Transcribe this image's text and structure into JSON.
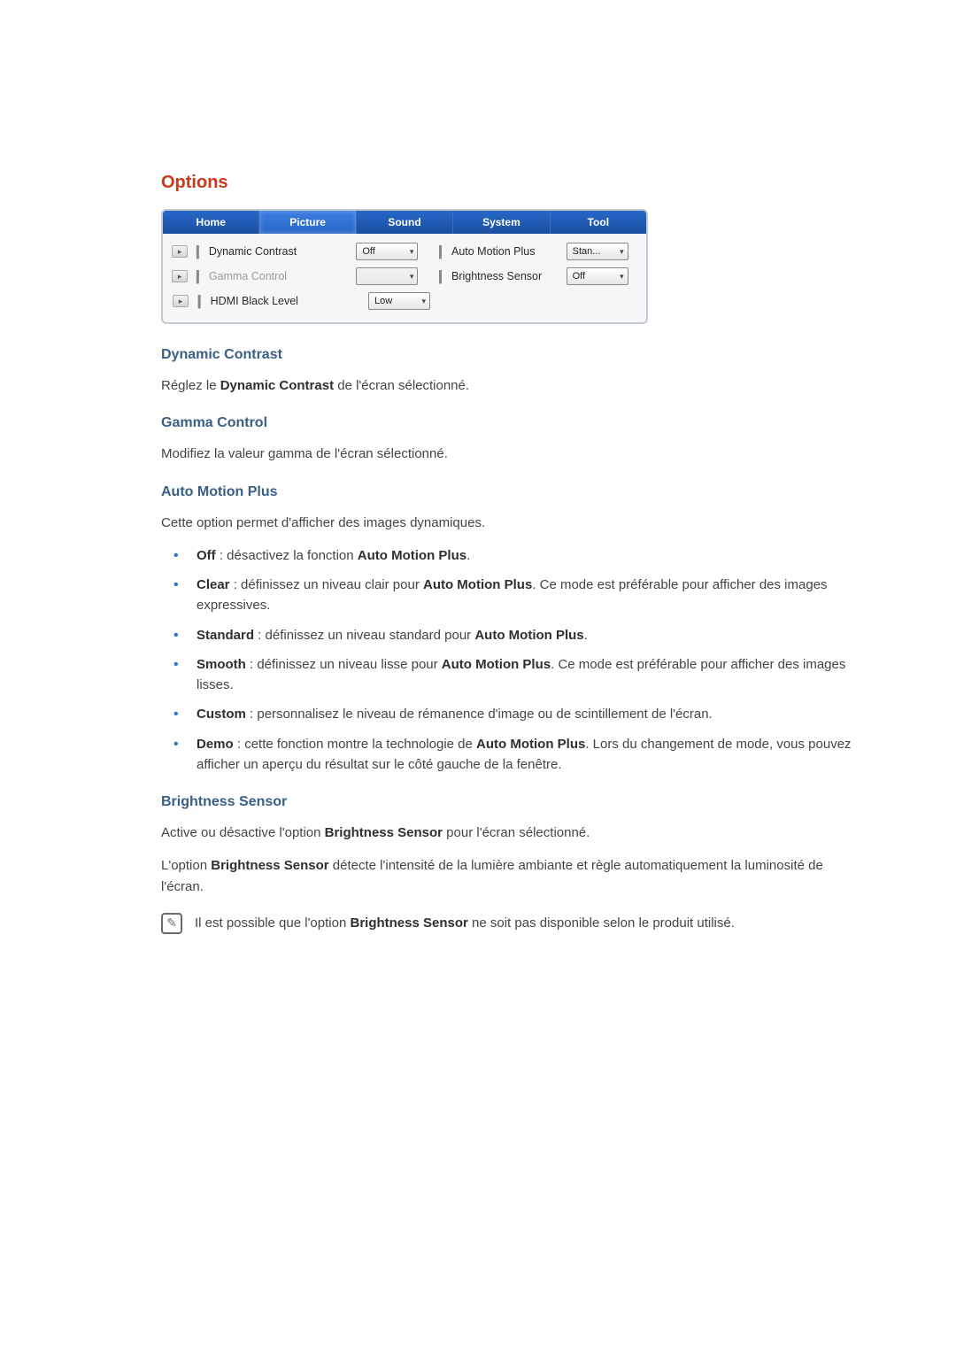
{
  "section_title": "Options",
  "panel": {
    "tabs": {
      "home": "Home",
      "picture": "Picture",
      "sound": "Sound",
      "system": "System",
      "tool": "Tool"
    },
    "rows": {
      "dynamic_contrast": {
        "label": "Dynamic Contrast",
        "value": "Off"
      },
      "gamma_control": {
        "label": "Gamma Control",
        "value": ""
      },
      "hdmi_black_level": {
        "label": "HDMI Black Level",
        "value": "Low"
      },
      "auto_motion_plus": {
        "label": "Auto Motion Plus",
        "value": "Stan..."
      },
      "brightness_sensor": {
        "label": "Brightness Sensor",
        "value": "Off"
      }
    }
  },
  "dc": {
    "heading": "Dynamic Contrast",
    "text_a": "Réglez le ",
    "text_b": "Dynamic Contrast",
    "text_c": " de l'écran sélectionné."
  },
  "gc": {
    "heading": "Gamma Control",
    "text": "Modifiez la valeur gamma de l'écran sélectionné."
  },
  "amp": {
    "heading": "Auto Motion Plus",
    "intro": "Cette option permet d'afficher des images dynamiques.",
    "items": {
      "off_a": "Off",
      "off_b": " : désactivez la fonction ",
      "off_c": "Auto Motion Plus",
      "off_d": ".",
      "clear_a": "Clear",
      "clear_b": " : définissez un niveau clair pour ",
      "clear_c": "Auto Motion Plus",
      "clear_d": ". Ce mode est préférable pour afficher des images expressives.",
      "std_a": "Standard",
      "std_b": " : définissez un niveau standard pour ",
      "std_c": "Auto Motion Plus",
      "std_d": ".",
      "smooth_a": "Smooth",
      "smooth_b": " : définissez un niveau lisse pour ",
      "smooth_c": "Auto Motion Plus",
      "smooth_d": ". Ce mode est préférable pour afficher des images lisses.",
      "custom_a": "Custom",
      "custom_b": " : personnalisez le niveau de rémanence d'image ou de scintillement de l'écran.",
      "demo_a": "Demo",
      "demo_b": " : cette fonction montre la technologie de ",
      "demo_c": "Auto Motion Plus",
      "demo_d": ". Lors du changement de mode, vous pouvez afficher un aperçu du résultat sur le côté gauche de la fenêtre."
    }
  },
  "bs": {
    "heading": "Brightness Sensor",
    "p1_a": "Active ou désactive l'option ",
    "p1_b": "Brightness Sensor",
    "p1_c": " pour l'écran sélectionné.",
    "p2_a": "L'option ",
    "p2_b": "Brightness Sensor",
    "p2_c": " détecte l'intensité de la lumière ambiante et règle automatiquement la luminosité de l'écran.",
    "note_a": "Il est possible que l'option ",
    "note_b": "Brightness Sensor",
    "note_c": " ne soit pas disponible selon le produit utilisé."
  },
  "glyphs": {
    "chevron": "▸",
    "caret": "▾",
    "pencil": "✎"
  }
}
